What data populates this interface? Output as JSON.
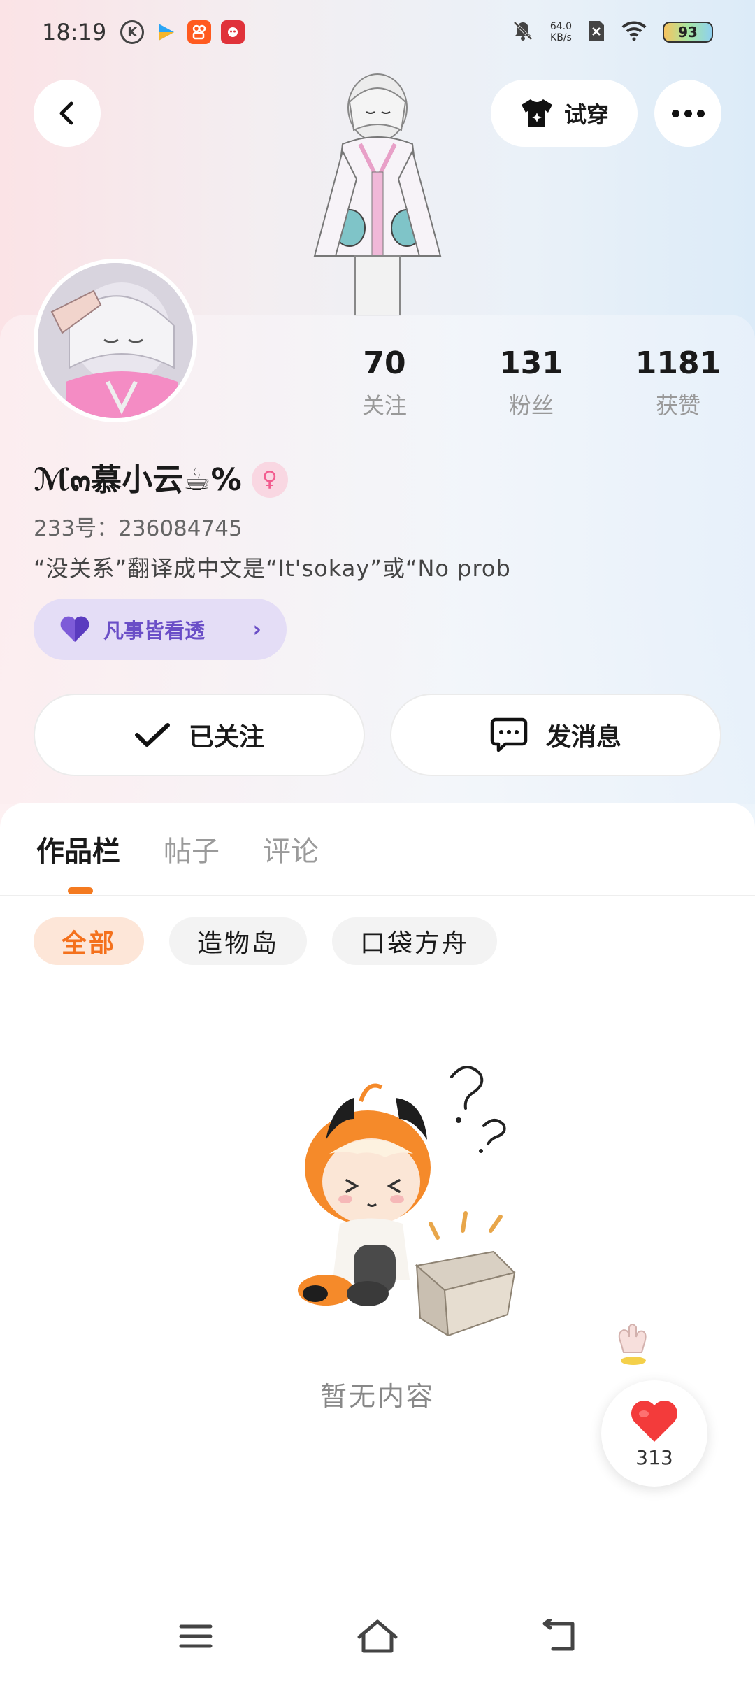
{
  "status_bar": {
    "time": "18:19",
    "net_speed_value": "64.0",
    "net_speed_unit": "KB/s",
    "battery": "93"
  },
  "header": {
    "tryon_label": "试穿"
  },
  "stats": [
    {
      "value": "70",
      "label": "关注"
    },
    {
      "value": "131",
      "label": "粉丝"
    },
    {
      "value": "1181",
      "label": "获赞"
    }
  ],
  "profile": {
    "nickname": "ℳ๓慕小云☕%",
    "gender_symbol": "♀",
    "uid": "233号：236084745",
    "bio": "“没关系”翻译成中文是“It'sokay”或“No prob",
    "tag": "凡事皆看透"
  },
  "actions": {
    "follow_label": "已关注",
    "message_label": "发消息"
  },
  "tabs": [
    {
      "label": "作品栏",
      "active": true
    },
    {
      "label": "帖子",
      "active": false
    },
    {
      "label": "评论",
      "active": false
    }
  ],
  "filters": [
    {
      "label": "全部",
      "active": true
    },
    {
      "label": "造物岛",
      "active": false
    },
    {
      "label": "口袋方舟",
      "active": false
    }
  ],
  "empty_state": {
    "text": "暂无内容"
  },
  "float_like": {
    "count": "313"
  },
  "colors": {
    "accent_orange": "#f47a20",
    "tag_purple": "#6a4ec7",
    "like_red": "#f33b3b"
  }
}
